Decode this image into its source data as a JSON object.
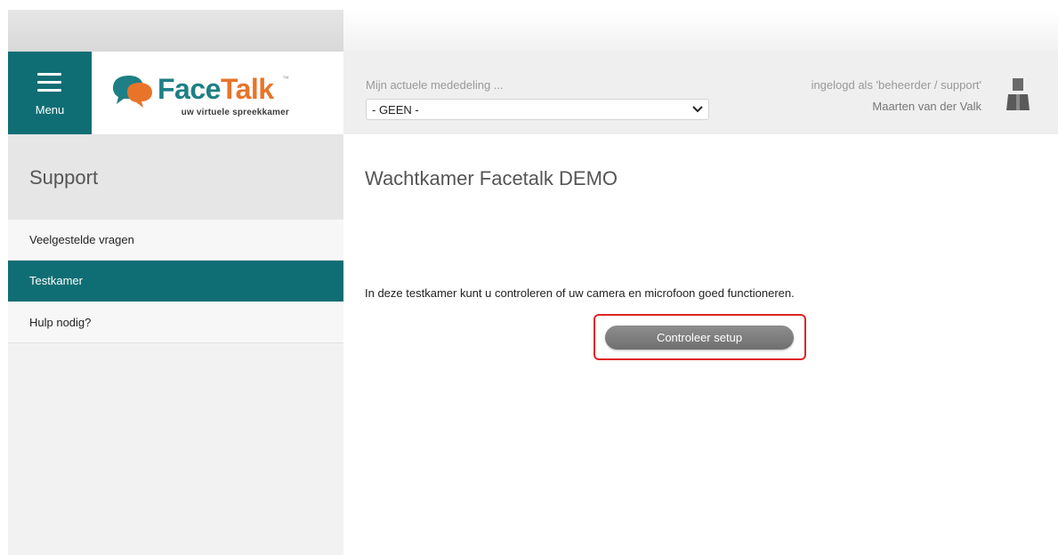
{
  "menu": {
    "label": "Menu"
  },
  "logo": {
    "brand_face": "Face",
    "brand_talk": "Talk",
    "trademark": "™",
    "tagline": "uw virtuele spreekkamer"
  },
  "announcement": {
    "label": "Mijn actuele mededeling ...",
    "selected": "- GEEN -"
  },
  "user": {
    "role_line": "ingelogd als 'beheerder / support'",
    "name": "Maarten van der Valk"
  },
  "sidebar": {
    "title": "Support",
    "items": [
      {
        "label": "Veelgestelde vragen",
        "active": false
      },
      {
        "label": "Testkamer",
        "active": true
      },
      {
        "label": "Hulp nodig?",
        "active": false
      }
    ]
  },
  "main": {
    "title": "Wachtkamer Facetalk DEMO",
    "intro": "In deze testkamer kunt u controleren of uw camera en microfoon goed functioneren.",
    "check_button": "Controleer setup"
  },
  "colors": {
    "accent": "#0f6e74",
    "brand_teal": "#1e7f86",
    "brand_orange": "#e8742a",
    "highlight": "#e02424"
  },
  "icons": {
    "menu": "hamburger-icon",
    "logo": "speech-bubbles-icon",
    "user": "user-avatar-icon",
    "dropdown": "chevron-down-icon"
  }
}
